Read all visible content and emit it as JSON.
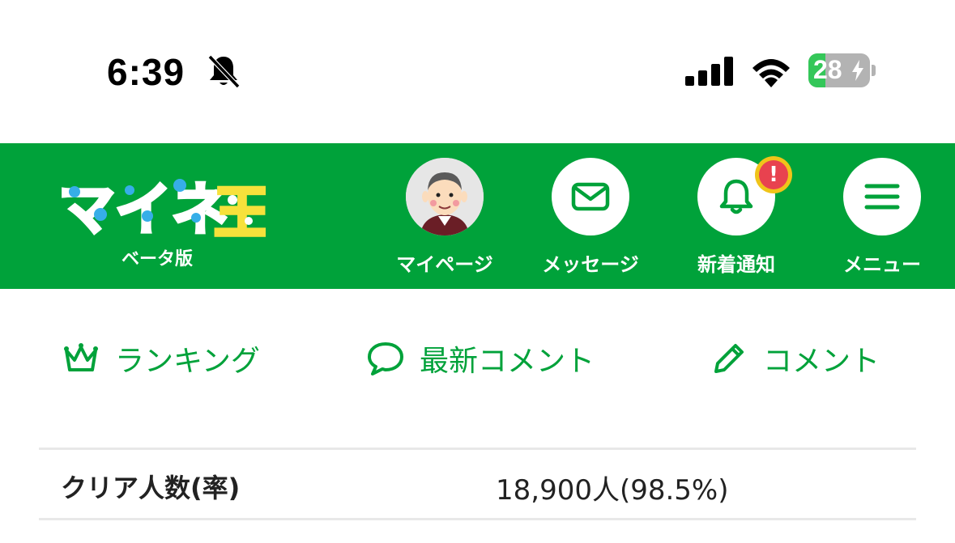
{
  "status_bar": {
    "time": "6:39",
    "battery_level": "28",
    "battery_fraction": 0.28,
    "icons": [
      "bell-slash-icon",
      "cellular-signal-icon",
      "wifi-icon",
      "battery-charging-icon"
    ]
  },
  "header": {
    "logo_text": "マイネ王",
    "logo_sub": "ベータ版",
    "brand_color": "#00a23a",
    "nav": [
      {
        "label": "マイページ",
        "icon": "avatar"
      },
      {
        "label": "メッセージ",
        "icon": "mail-icon"
      },
      {
        "label": "新着通知",
        "icon": "bell-icon",
        "badge": "!"
      },
      {
        "label": "メニュー",
        "icon": "hamburger-icon"
      }
    ]
  },
  "tabs": [
    {
      "label": "ランキング",
      "icon": "crown-icon"
    },
    {
      "label": "最新コメント",
      "icon": "speech-bubble-icon"
    },
    {
      "label": "コメント",
      "icon": "pencil-icon"
    }
  ],
  "stats": {
    "label": "クリア人数(率)",
    "value": "18,900人(98.5%)"
  }
}
